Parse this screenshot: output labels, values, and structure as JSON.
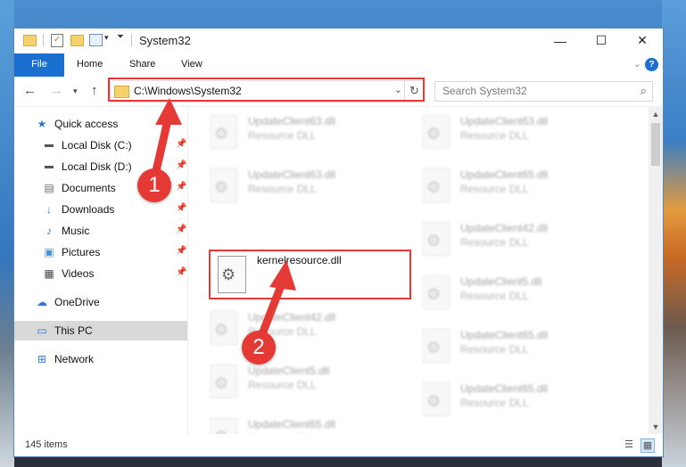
{
  "window": {
    "title": "System32",
    "controls": {
      "minimize": "—",
      "maximize": "☐",
      "close": "✕"
    }
  },
  "ribbon": {
    "tabs": [
      "File",
      "Home",
      "Share",
      "View"
    ],
    "help": "?"
  },
  "address": {
    "path": "C:\\Windows\\System32",
    "search_placeholder": "Search System32"
  },
  "nav_pane": {
    "items": [
      {
        "label": "Quick access",
        "icon": "star-icon"
      },
      {
        "label": "Local Disk (C:)",
        "icon": "drive-icon",
        "pinned": true
      },
      {
        "label": "Local Disk (D:)",
        "icon": "drive-icon",
        "pinned": true
      },
      {
        "label": "Documents",
        "icon": "documents-icon",
        "pinned": true
      },
      {
        "label": "Downloads",
        "icon": "download-icon",
        "pinned": true
      },
      {
        "label": "Music",
        "icon": "music-icon",
        "pinned": true
      },
      {
        "label": "Pictures",
        "icon": "pictures-icon",
        "pinned": true
      },
      {
        "label": "Videos",
        "icon": "videos-icon",
        "pinned": true
      },
      {
        "label": "OneDrive",
        "icon": "cloud-icon"
      },
      {
        "label": "This PC",
        "icon": "computer-icon",
        "selected": true
      },
      {
        "label": "Network",
        "icon": "network-icon"
      }
    ]
  },
  "files": [
    {
      "name": "UpdateClient63.dll",
      "type": "Resource DLL"
    },
    {
      "name": "UpdateClient63.dll",
      "type": "Resource DLL"
    },
    {
      "name": "UpdateClient63.dll",
      "type": "Resource DLL"
    },
    {
      "name": "UpdateClient65.dll",
      "type": "Resource DLL"
    },
    {
      "name": "kernelresource.dll",
      "type": "",
      "selected": true
    },
    {
      "name": "UpdateClient42.dll",
      "type": "Resource DLL"
    },
    {
      "name": "UpdateClient42.dll",
      "type": "Resource DLL"
    },
    {
      "name": "UpdateClient5.dll",
      "type": "Resource DLL"
    },
    {
      "name": "UpdateClient5.dll",
      "type": "Resource DLL"
    },
    {
      "name": "UpdateClient65.dll",
      "type": "Resource DLL"
    },
    {
      "name": "UpdateClient65.dll",
      "type": "Resource DLL"
    },
    {
      "name": "UpdateClient65.dll",
      "type": "Resource DLL"
    }
  ],
  "status": {
    "item_count": "145 items"
  },
  "annotations": {
    "step1": "1",
    "step2": "2",
    "color": "#e53935"
  }
}
